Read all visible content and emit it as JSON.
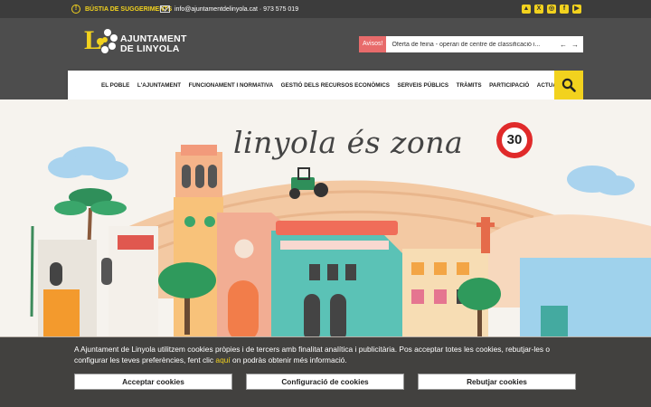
{
  "topbar": {
    "suggestions": "BÚSTIA DE SUGGERIMENTS",
    "suggestions_icon": "exclamation-icon",
    "contact": "info@ajuntamentdelinyola.cat · 973 575 019",
    "contact_icon": "envelope-icon",
    "social": [
      {
        "name": "instagram-alt",
        "glyph": "▲"
      },
      {
        "name": "x",
        "glyph": "X"
      },
      {
        "name": "instagram",
        "glyph": "◎"
      },
      {
        "name": "facebook",
        "glyph": "f"
      },
      {
        "name": "youtube",
        "glyph": "▶"
      }
    ]
  },
  "logo": {
    "line1": "AJUNTAMENT",
    "line2": "DE LINYOLA",
    "letter": "L"
  },
  "notice": {
    "tag": "Avisos!",
    "text": "Oferta de feina - operari de centre de classificació i...",
    "prev": "←",
    "next": "→"
  },
  "nav": {
    "items": [
      "EL POBLE",
      "L'AJUNTAMENT",
      "FUNCIONAMENT I NORMATIVA",
      "GESTIÓ DELS RECURSOS ECONÒMICS",
      "SERVEIS PÚBLICS",
      "TRÀMITS",
      "PARTICIPACIÓ",
      "ACTUALITAT"
    ],
    "search_icon": "search-icon"
  },
  "hero": {
    "slogan": "linyola és zona",
    "sign": "30"
  },
  "cookie": {
    "text_before": "A Ajuntament de Linyola utilitzem cookies pròpies i de tercers amb finalitat analítica i publicitària. Pos acceptar totes les cookies, rebutjar-les o configurar les teves preferències, fent clic ",
    "link": "aquí",
    "text_after": " on podràs obtenir més informació.",
    "accept": "Acceptar cookies",
    "configure": "Configuració de cookies",
    "reject": "Rebutjar cookies"
  },
  "colors": {
    "accent": "#f2d21e",
    "dark": "#4d4d4d",
    "notice": "#e86b6b"
  }
}
